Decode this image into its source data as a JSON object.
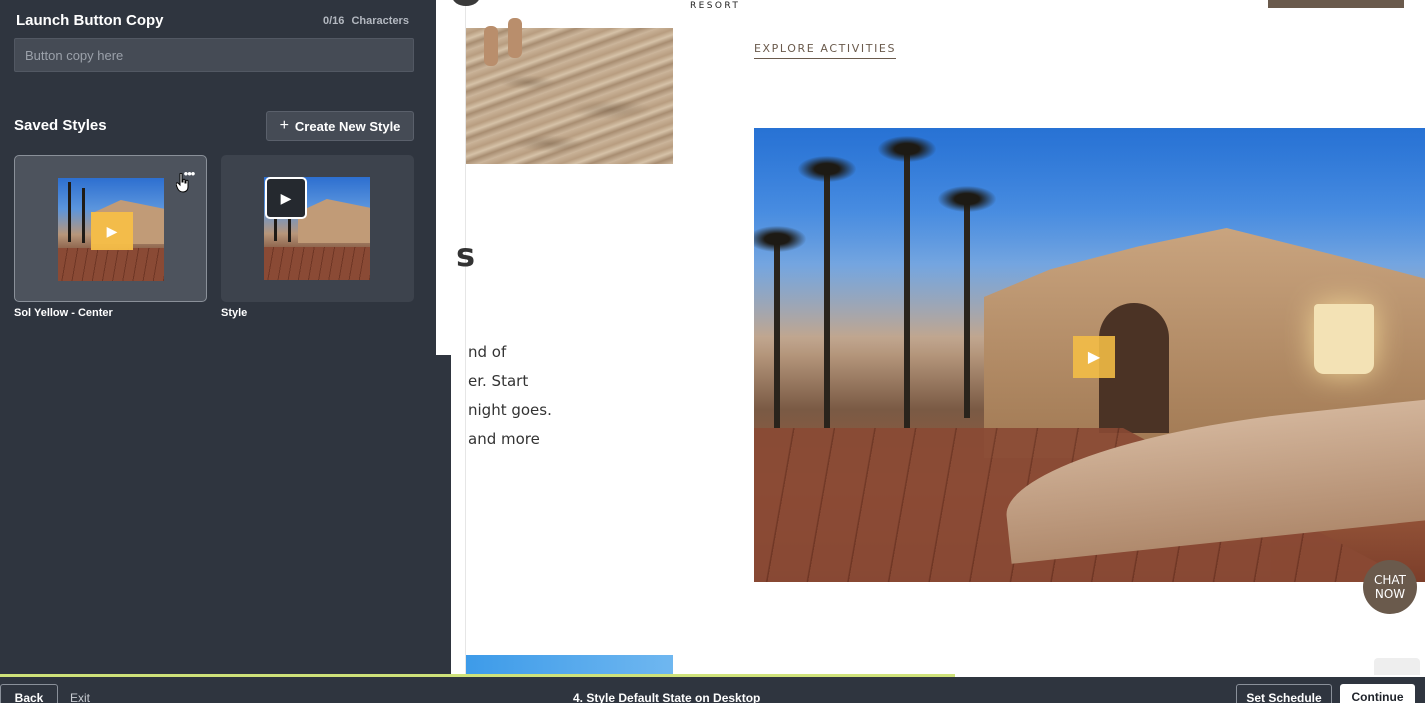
{
  "launch_button_copy": {
    "title": "Launch Button Copy",
    "count": "0/16",
    "count_label": "Characters",
    "input_value": "",
    "input_placeholder": "Button copy here"
  },
  "saved_styles": {
    "title": "Saved Styles",
    "create_button_label": "Create New Style",
    "create_button_icon": "plus-icon",
    "items": [
      {
        "label": "Sol Yellow - Center",
        "play_style": "yellow",
        "play_color": "#f6be48",
        "selected": true
      },
      {
        "label": "Style",
        "play_style": "dark",
        "play_color": "#25292f",
        "selected": false
      }
    ]
  },
  "preview": {
    "resort_label": "RESORT",
    "explore_link": "EXPLORE ACTIVITIES",
    "heading_fragment": "s",
    "body_lines": [
      "nd of",
      "er. Start",
      "night goes.",
      "and more"
    ],
    "chat_line1": "CHAT",
    "chat_line2": "NOW",
    "hero_play_color": "#f5be46"
  },
  "footer": {
    "back_label": "Back",
    "exit_label": "Exit",
    "step_title": "4. Style Default State on Desktop",
    "schedule_label": "Set Schedule",
    "continue_label": "Continue",
    "progress_color": "#cfe27a",
    "progress_fraction": 0.67
  },
  "colors": {
    "panel_bg": "#2f353f",
    "accent_brown": "#6a5a4c"
  }
}
